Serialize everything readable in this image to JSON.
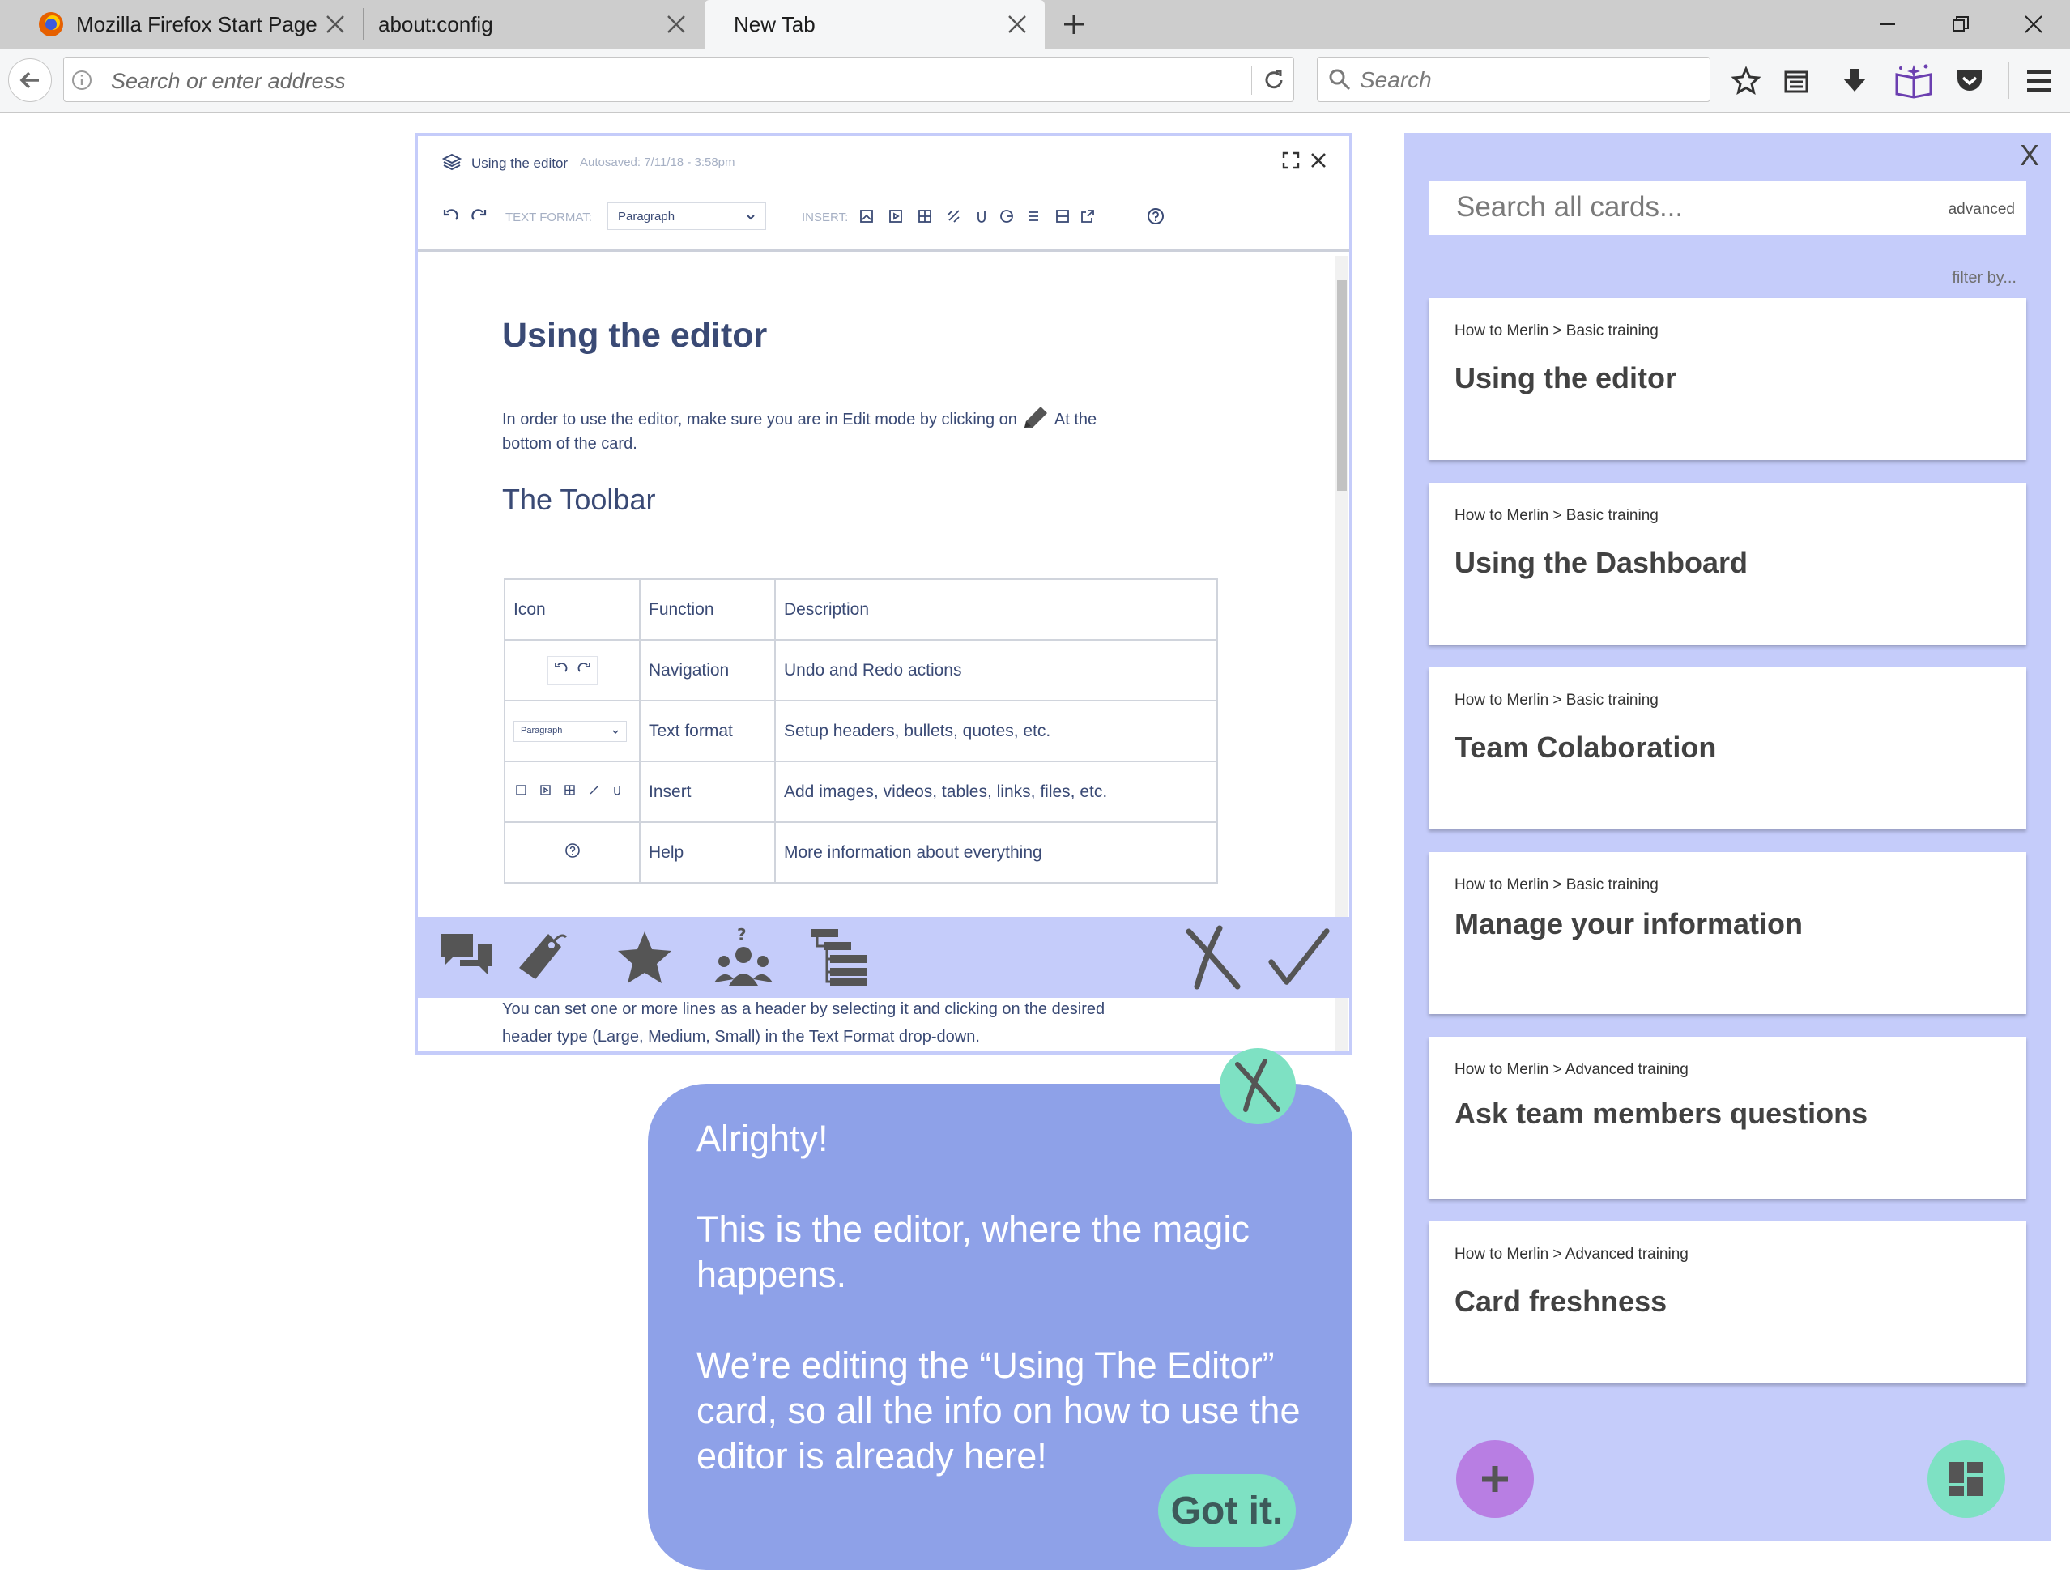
{
  "browser": {
    "tabs": [
      {
        "label": "Mozilla Firefox Start Page"
      },
      {
        "label": "about:config"
      },
      {
        "label": "New Tab"
      }
    ],
    "url_placeholder": "Search or enter address",
    "search_placeholder": "Search"
  },
  "editor": {
    "header_title": "Using the editor",
    "autosaved": "Autosaved: 7/11/18 - 3:58pm",
    "text_format_label": "TEXT FORMAT:",
    "text_format_value": "Paragraph",
    "insert_label": "INSERT:",
    "doc": {
      "title": "Using the editor",
      "intro_1": "In order to use the editor, make sure you are in Edit mode by clicking on",
      "intro_2": "At the",
      "intro_3": "bottom of the card.",
      "section": "The Toolbar",
      "table": {
        "headers": [
          "Icon",
          "Function",
          "Description"
        ],
        "rows": [
          {
            "function": "Navigation",
            "description": "Undo and Redo actions"
          },
          {
            "function": "Text format",
            "description": "Setup headers, bullets, quotes, etc.",
            "icon_text": "Paragraph"
          },
          {
            "function": "Insert",
            "description": "Add images, videos, tables, links, files, etc."
          },
          {
            "function": "Help",
            "description": "More information about everything"
          }
        ]
      },
      "footer_line_1": "You can set one or more lines as a header by selecting it and clicking on the desired",
      "footer_line_2": "header type (Large, Medium, Small) in the Text Format drop-down."
    }
  },
  "tooltip": {
    "line_1": "Alrighty!",
    "line_2": "This is the editor, where the magic happens.",
    "line_3": "We’re editing the “Using The Editor” card, so all the info on how to use the editor is already here!",
    "got_it": "Got it."
  },
  "panel": {
    "close": "X",
    "search_placeholder": "Search all cards...",
    "advanced": "advanced",
    "filter": "filter by...",
    "cards": [
      {
        "crumb": "How to Merlin > Basic training",
        "title": "Using the editor"
      },
      {
        "crumb": "How to Merlin > Basic training",
        "title": "Using the Dashboard"
      },
      {
        "crumb": "How to Merlin > Basic training",
        "title": "Team Colaboration"
      },
      {
        "crumb": "How to Merlin > Basic training",
        "title": "Manage your information"
      },
      {
        "crumb": "How to Merlin > Advanced training",
        "title": "Ask team members questions"
      },
      {
        "crumb": "How to Merlin > Advanced training",
        "title": "Card freshness"
      }
    ]
  },
  "colors": {
    "panel_bg": "#c5ccfa",
    "bubble_bg": "#8ea1e8",
    "accent_green": "#7ee1c3",
    "accent_purple": "#b87ee3",
    "doc_text": "#3a4a75"
  }
}
